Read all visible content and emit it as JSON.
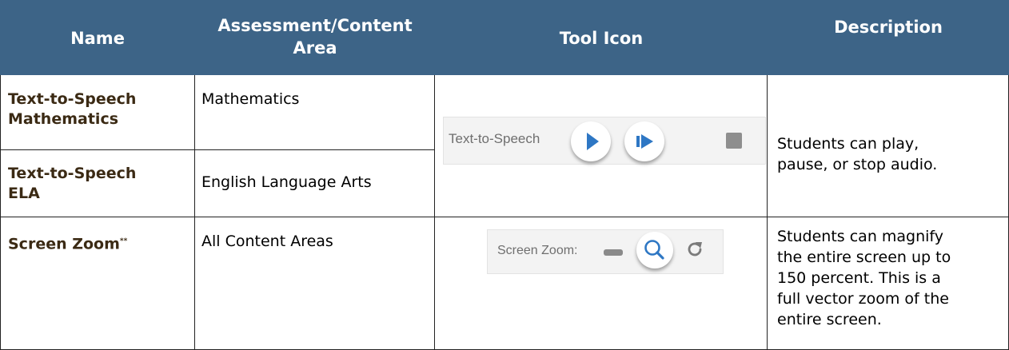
{
  "table": {
    "headers": {
      "name": "Name",
      "area_line1": "Assessment/Content",
      "area_line2": "Area",
      "tool_icon": "Tool Icon",
      "description": "Description"
    },
    "rows": [
      {
        "name_line1": "Text-to-Speech",
        "name_line2": "Mathematics",
        "area": "Mathematics"
      },
      {
        "name_line1": "Text-to-Speech",
        "name_line2": "ELA",
        "area": "English Language Arts"
      },
      {
        "name": "Screen Zoom",
        "name_marker": "**",
        "area": "All Content Areas"
      }
    ],
    "tts_description_line1": "Students can play,",
    "tts_description_line2": "pause, or stop audio.",
    "zoom_description_lines": [
      "Students can magnify",
      "the entire screen up to",
      "150 percent. This is a",
      "full vector zoom of the",
      "entire screen."
    ]
  },
  "tts_toolbar": {
    "label": "Text-to-Speech",
    "icons": [
      "play-icon",
      "play-from-here-icon",
      "stop-icon"
    ]
  },
  "zoom_toolbar": {
    "label": "Screen Zoom:",
    "icons": [
      "zoom-out-icon",
      "zoom-in-magnifier-icon",
      "reset-zoom-icon"
    ]
  },
  "colors": {
    "header_bg": "#3d6487",
    "header_text": "#ffffff",
    "name_text": "#3b2a14",
    "play_icon": "#2e77c4"
  }
}
